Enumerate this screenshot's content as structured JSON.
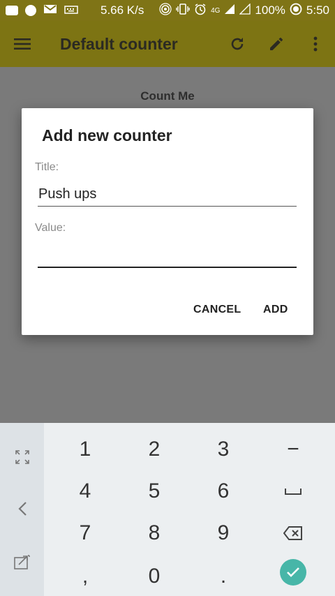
{
  "status_bar": {
    "speed": "5.66 K/s",
    "battery": "100%",
    "time": "5:50",
    "network": "4G",
    "icons": [
      "chat-icon",
      "music-icon",
      "mail-icon",
      "keyboard-icon",
      "hotspot-icon",
      "vibrate-icon",
      "alarm-icon",
      "signal-icon",
      "battery-icon"
    ]
  },
  "app_bar": {
    "title": "Default counter",
    "icons": [
      "menu-icon",
      "refresh-icon",
      "edit-icon",
      "more-vert-icon"
    ]
  },
  "content": {
    "counter_label": "Count Me"
  },
  "dialog": {
    "title": "Add new counter",
    "title_field": {
      "label": "Title:",
      "value": "Push ups"
    },
    "value_field": {
      "label": "Value:",
      "value": ""
    },
    "cancel_label": "CANCEL",
    "add_label": "ADD"
  },
  "keyboard": {
    "keys": {
      "k1": "1",
      "k2": "2",
      "k3": "3",
      "minus": "−",
      "k4": "4",
      "k5": "5",
      "k6": "6",
      "k7": "7",
      "k8": "8",
      "k9": "9",
      "comma": ",",
      "k0": "0",
      "dot": "."
    },
    "side_icons": [
      "expand-icon",
      "back-arrow-icon",
      "floating-keyboard-icon"
    ],
    "special_icons": [
      "space-icon",
      "backspace-icon",
      "done-check-icon"
    ]
  },
  "colors": {
    "app_bar": "#7d7413",
    "scrim_background": "#7a7a7a",
    "dialog": "#ffffff",
    "keyboard": "#eceff1",
    "accent_done": "#47b6a8"
  }
}
